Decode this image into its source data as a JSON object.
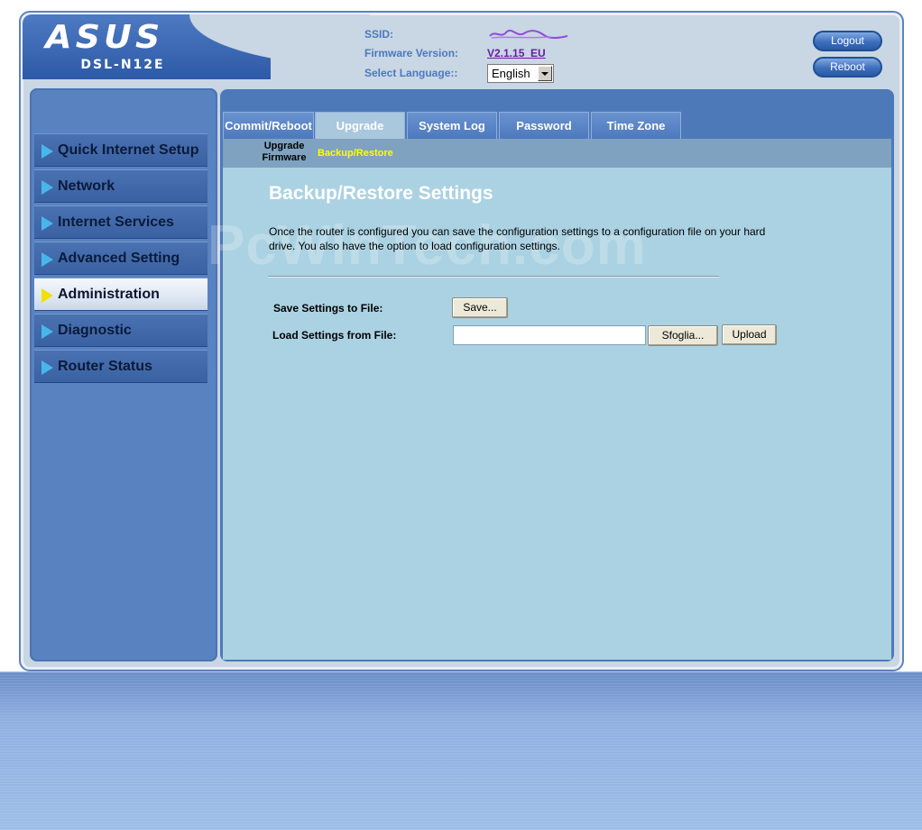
{
  "header": {
    "brand": "ASUS",
    "model": "DSL-N12E",
    "ssid_label": "SSID:",
    "firmware_label": "Firmware Version:",
    "firmware_value": "V2.1.15_EU",
    "language_label": "Select Language::",
    "language_value": "English",
    "logout_label": "Logout",
    "reboot_label": "Reboot"
  },
  "sidebar": {
    "items": [
      {
        "label": "Quick Internet Setup"
      },
      {
        "label": "Network"
      },
      {
        "label": "Internet Services"
      },
      {
        "label": "Advanced Setting"
      },
      {
        "label": "Administration",
        "active": true
      },
      {
        "label": "Diagnostic"
      },
      {
        "label": "Router Status"
      }
    ]
  },
  "tabs": [
    {
      "label": "Commit/Reboot"
    },
    {
      "label": "Upgrade",
      "active": true
    },
    {
      "label": "System Log"
    },
    {
      "label": "Password"
    },
    {
      "label": "Time Zone"
    }
  ],
  "subnav": {
    "upgrade_line1": "Upgrade",
    "upgrade_line2": "Firmware",
    "backup_restore": "Backup/Restore"
  },
  "main": {
    "watermark": "PcWinTech.com",
    "title": "Backup/Restore Settings",
    "description": "Once the router is configured you can save the configuration settings to a configuration file on your hard drive. You also have the option to load configuration settings.",
    "save_label": "Save Settings to File:",
    "save_button": "Save...",
    "load_label": "Load Settings from File:",
    "file_value": "",
    "browse_button": "Sfoglia...",
    "upload_button": "Upload"
  }
}
